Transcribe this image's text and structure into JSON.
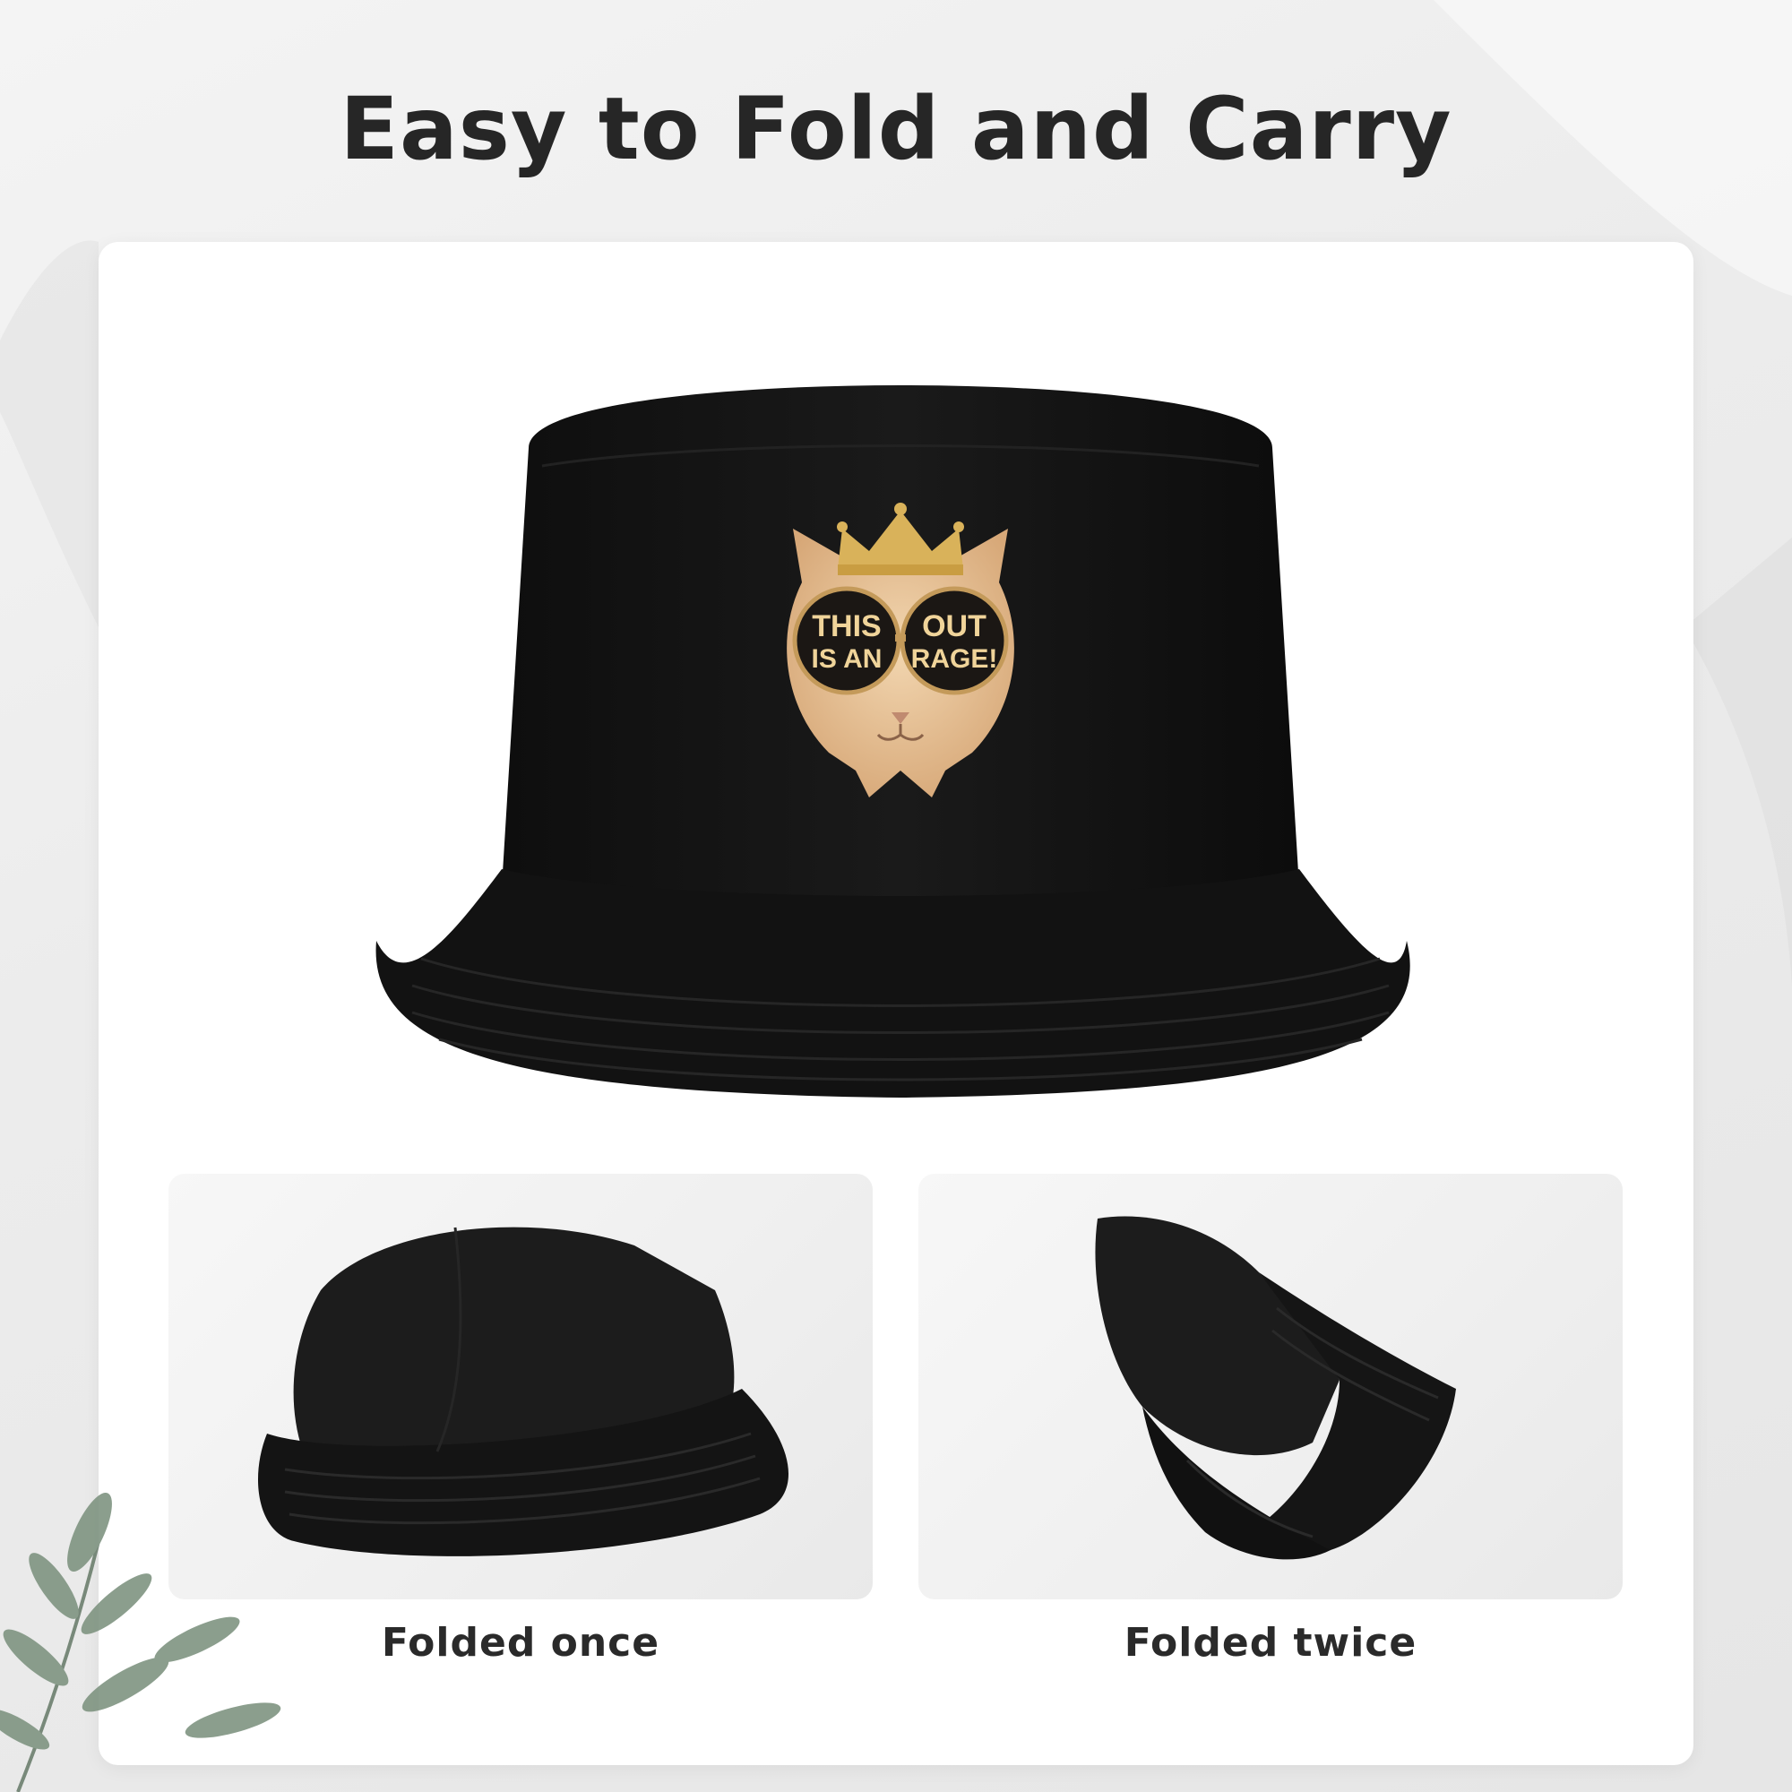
{
  "headline": "Easy to Fold and Carry",
  "print": {
    "lens_left": [
      "THIS",
      "IS AN"
    ],
    "lens_right": [
      "OUT",
      "RAGE!"
    ]
  },
  "panels": [
    {
      "caption": "Folded once"
    },
    {
      "caption": "Folded twice"
    }
  ],
  "colors": {
    "hat": "#151515",
    "print_fur": "#e8c49a",
    "crown_gold": "#d9b25a",
    "text_dark": "#262626"
  }
}
